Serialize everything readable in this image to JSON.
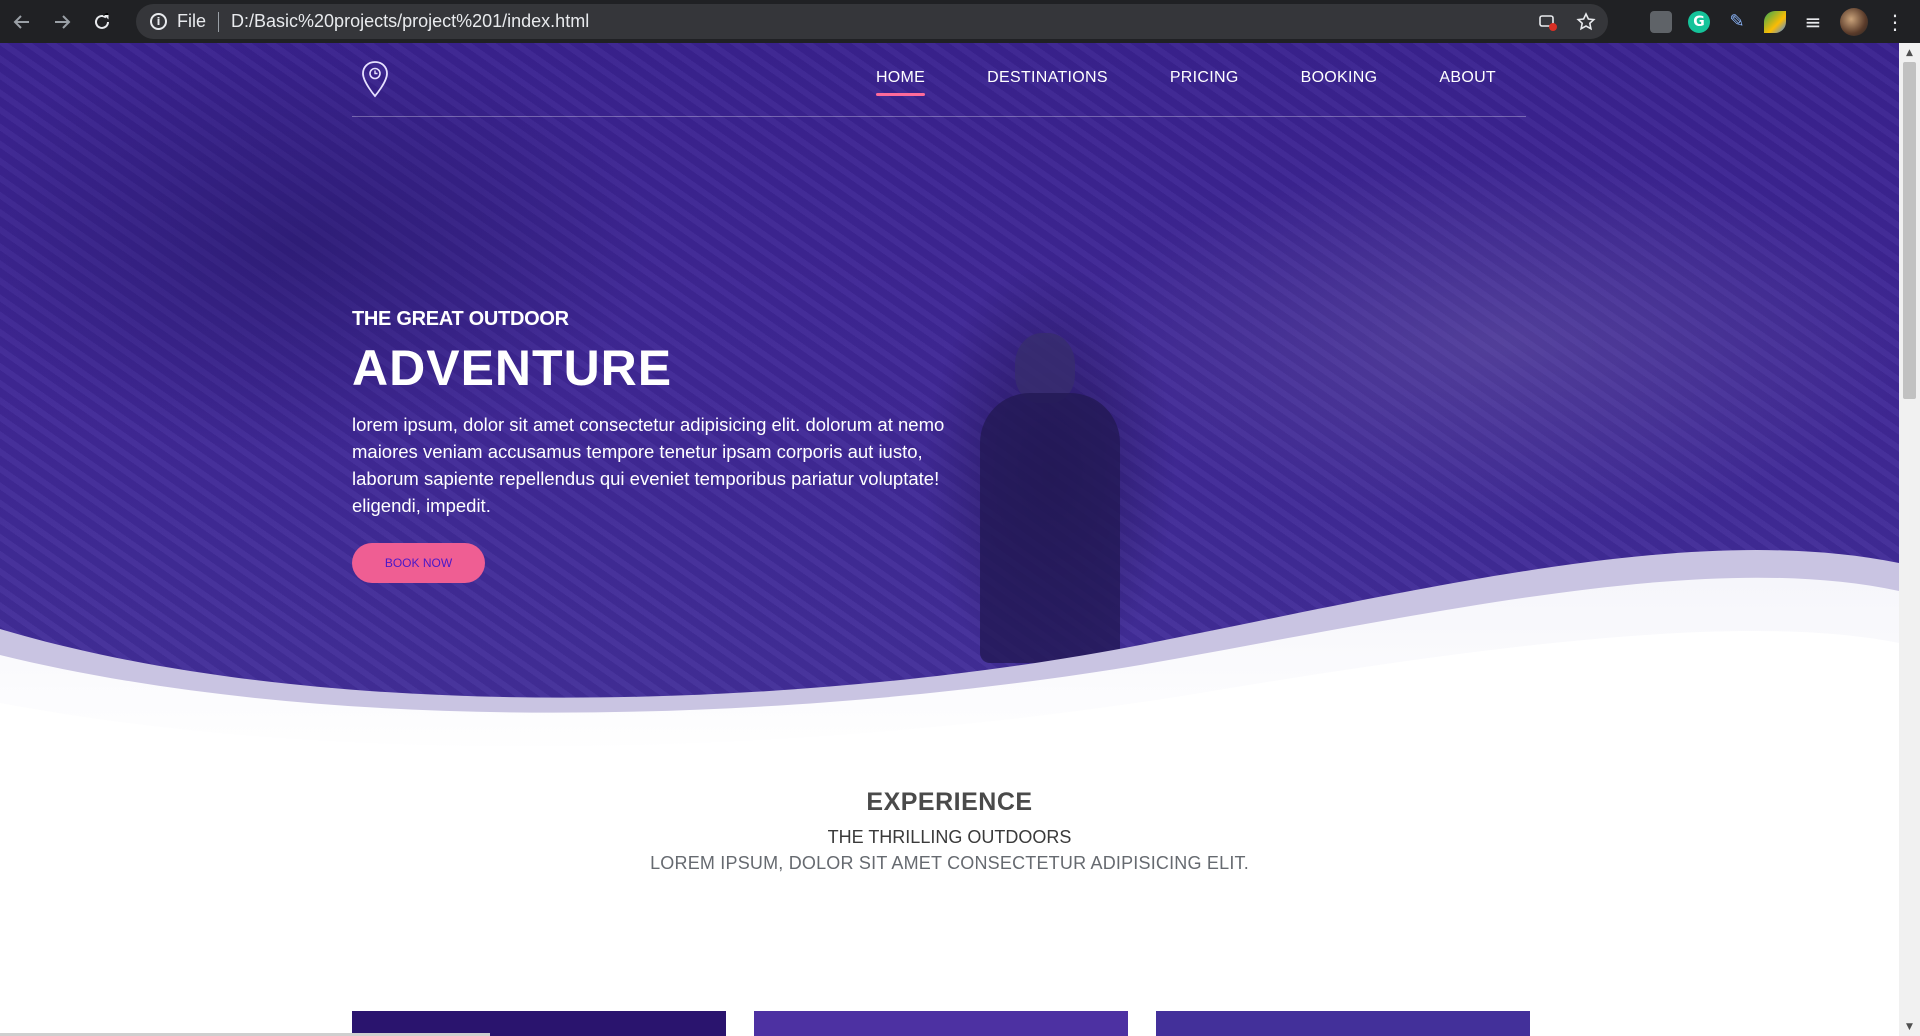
{
  "browser": {
    "scheme_label": "File",
    "url": "D:/Basic%20projects/project%201/index.html",
    "extensions": [
      "grammarly-icon"
    ]
  },
  "site": {
    "nav": {
      "items": [
        {
          "label": "HOME",
          "active": true
        },
        {
          "label": "DESTINATIONS"
        },
        {
          "label": "PRICING"
        },
        {
          "label": "BOOKING"
        },
        {
          "label": "ABOUT"
        }
      ]
    },
    "hero": {
      "subtitle": "THE GREAT OUTDOOR",
      "title": "ADVENTURE",
      "lead": "lorem ipsum, dolor sit amet consectetur adipisicing elit. dolorum at nemo maiores veniam accusamus tempore tenetur ipsam corporis aut iusto, laborum sapiente repellendus qui eveniet temporibus pariatur voluptate! eligendi, impedit.",
      "button": "BOOK NOW"
    },
    "experience": {
      "title": "EXPERIENCE",
      "subtitle": "THE THRILLING OUTDOORS",
      "description": "LOREM IPSUM, DOLOR SIT AMET CONSECTETUR ADIPISICING ELIT."
    }
  },
  "colors": {
    "hero_purple": "#3f2796",
    "accent_pink": "#ef5e93",
    "button_text": "#4a18c8",
    "chrome_dark": "#202124"
  }
}
